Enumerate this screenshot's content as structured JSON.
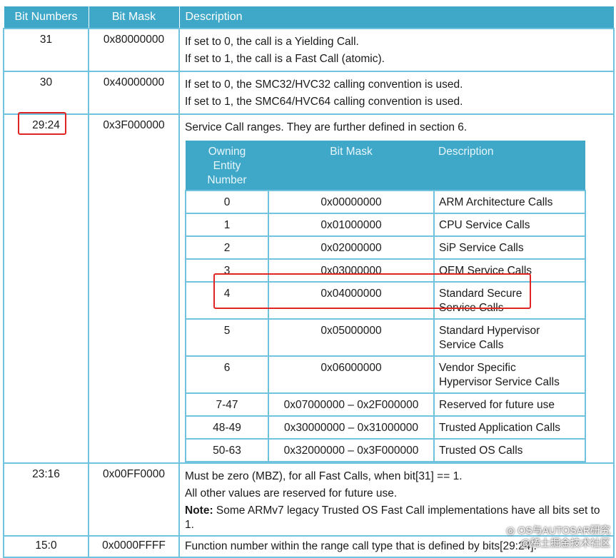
{
  "header": {
    "bit_numbers": "Bit Numbers",
    "bit_mask": "Bit Mask",
    "description": "Description"
  },
  "rows": [
    {
      "bits": "31",
      "mask": "0x80000000",
      "lines": [
        "If set to 0, the call is a Yielding Call.",
        "If set to 1, the call is a Fast Call (atomic)."
      ]
    },
    {
      "bits": "30",
      "mask": "0x40000000",
      "lines": [
        "If set to 0, the SMC32/HVC32 calling convention is used.",
        "If set to 1, the SMC64/HVC64 calling convention is used."
      ]
    },
    {
      "bits": "29:24",
      "mask": "0x3F000000",
      "lines": [
        "Service Call ranges. They are further defined in section 6."
      ]
    },
    {
      "bits": "23:16",
      "mask": "0x00FF0000",
      "lines": [
        "Must be zero (MBZ), for all Fast Calls, when bit[31] == 1.",
        "All other values are reserved for future use."
      ],
      "note_label": "Note:",
      "note_text": " Some ARMv7 legacy Trusted OS Fast Call implementations have all bits set to 1."
    },
    {
      "bits": "15:0",
      "mask": "0x0000FFFF",
      "lines": [
        "Function number within the range call type that is defined by bits[29:24]."
      ]
    }
  ],
  "inner_table": {
    "header": {
      "owning_line1": "Owning",
      "owning_line2": "Entity",
      "owning_line3": "Number",
      "bit_mask": "Bit Mask",
      "description": "Description"
    },
    "rows": [
      {
        "num": "0",
        "mask": "0x00000000",
        "desc1": "ARM Architecture Calls",
        "desc2": ""
      },
      {
        "num": "1",
        "mask": "0x01000000",
        "desc1": "CPU Service Calls",
        "desc2": ""
      },
      {
        "num": "2",
        "mask": "0x02000000",
        "desc1": "SiP Service Calls",
        "desc2": ""
      },
      {
        "num": "3",
        "mask": "0x03000000",
        "desc1": "OEM Service Calls",
        "desc2": ""
      },
      {
        "num": "4",
        "mask": "0x04000000",
        "desc1": "Standard Secure",
        "desc2": "Service Calls"
      },
      {
        "num": "5",
        "mask": "0x05000000",
        "desc1": "Standard Hypervisor",
        "desc2": "Service Calls"
      },
      {
        "num": "6",
        "mask": "0x06000000",
        "desc1": "Vendor Specific",
        "desc2": "Hypervisor Service Calls"
      },
      {
        "num": "7-47",
        "mask": "0x07000000 – 0x2F000000",
        "desc1": "Reserved for future use",
        "desc2": ""
      },
      {
        "num": "48-49",
        "mask": "0x30000000 – 0x31000000",
        "desc1": "Trusted Application Calls",
        "desc2": ""
      },
      {
        "num": "50-63",
        "mask": "0x32000000 – 0x3F000000",
        "desc1": "Trusted OS Calls",
        "desc2": ""
      }
    ]
  },
  "highlights": {
    "color": "#e02424"
  },
  "watermark": {
    "icon": "wechat-icon",
    "line1": "OS与AUTOSAR研究",
    "line2": "@稀土掘金技术社区"
  }
}
